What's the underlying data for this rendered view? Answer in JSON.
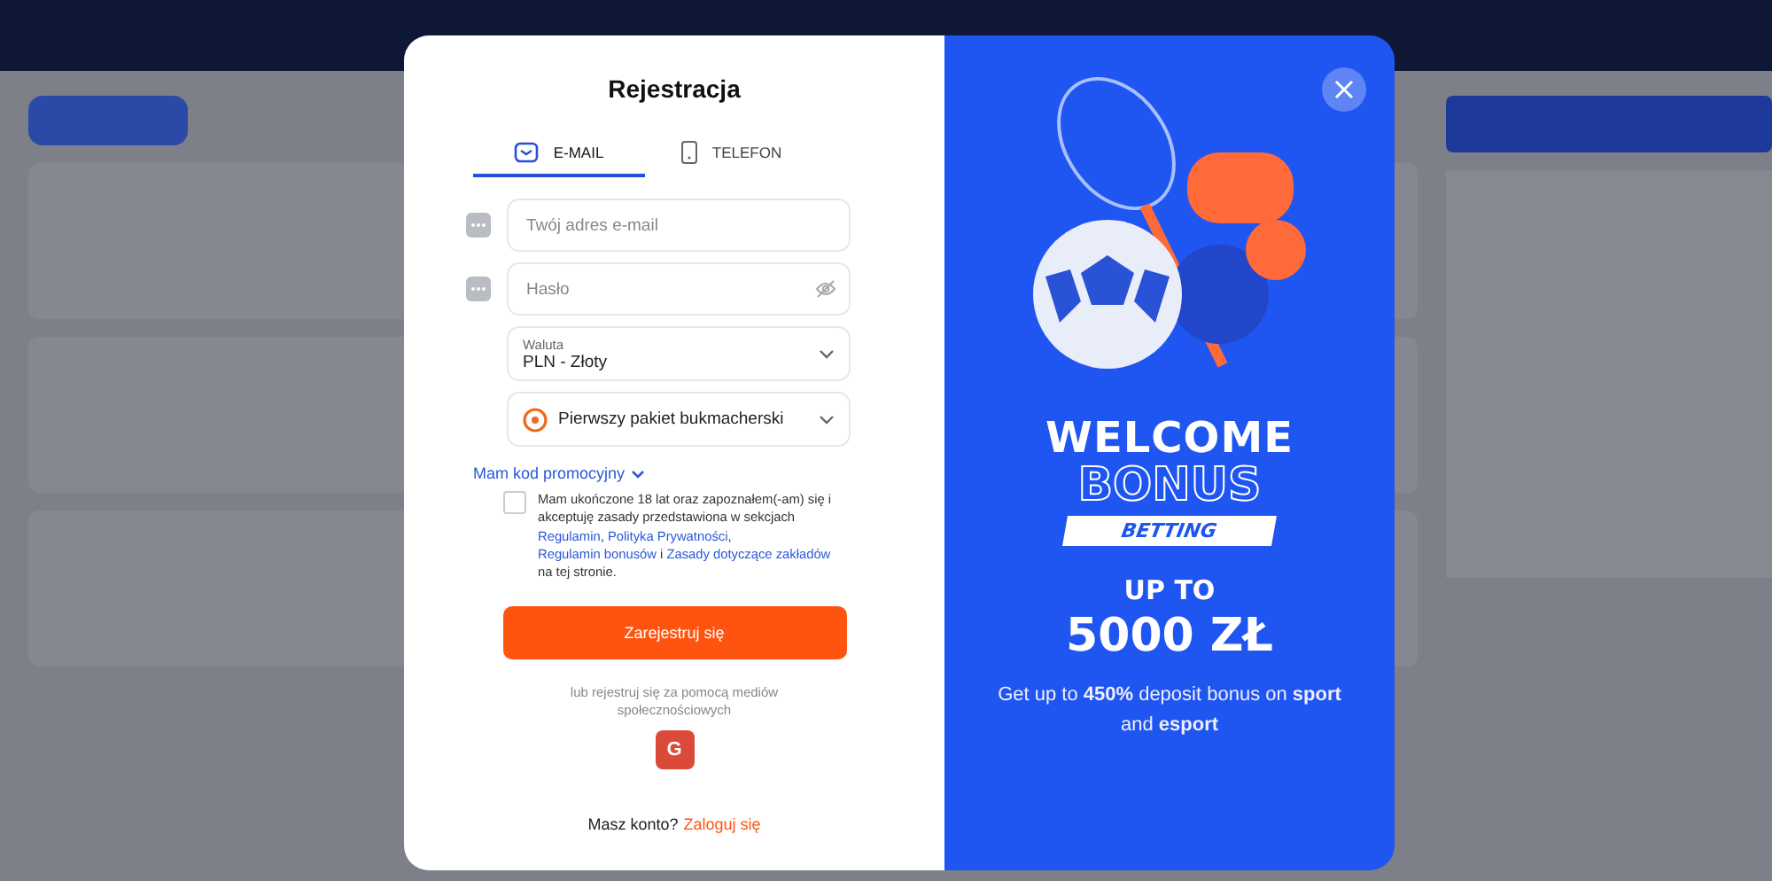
{
  "dialog": {
    "title": "Rejestracja",
    "tabs": [
      {
        "label": "E-MAIL",
        "selected": true
      },
      {
        "label": "TELEFON",
        "selected": false
      }
    ],
    "fields": [
      {
        "kind": "text",
        "placeholder": "Twój adres e-mail"
      },
      {
        "kind": "password",
        "placeholder": "Hasło"
      },
      {
        "kind": "select",
        "label": "Waluta",
        "value": "PLN - Złoty"
      },
      {
        "kind": "bonus-select",
        "value": "Pierwszy pakiet bukmacherski"
      }
    ],
    "promo_link": "Mam kod promocyjny",
    "consent": {
      "checked": false,
      "parts": [
        {
          "kind": "text",
          "text": "Mam ukończone 18 lat oraz zapoznałem(-am) się i akceptuję zasady przedstawiona w sekcjach "
        },
        {
          "kind": "link",
          "text": "Regulamin"
        },
        {
          "kind": "text",
          "text": ", "
        },
        {
          "kind": "link",
          "text": "Polityka Prywatności"
        },
        {
          "kind": "text",
          "text": ", "
        },
        {
          "kind": "link",
          "text": "Regulamin bonusów"
        },
        {
          "kind": "text",
          "text": " i "
        },
        {
          "kind": "link",
          "text": "Zasady dotyczące zakładów"
        },
        {
          "kind": "text",
          "text": " na tej stronie."
        }
      ]
    },
    "submit": "Zarejestruj się",
    "social_label": "lub rejestruj się za pomocą mediów społecznościowych",
    "social": [
      {
        "label": "G"
      }
    ],
    "login_prompt": "Masz konto?",
    "login_link": "Zaloguj się"
  },
  "promo": {
    "headline": "WELCOME",
    "headline_outline": "BONUS",
    "badge": "BETTING",
    "amount_label": "UP TO",
    "amount": "5000 ZŁ",
    "description": "Get up to **450%** deposit bonus on **sport** and **esport**"
  }
}
